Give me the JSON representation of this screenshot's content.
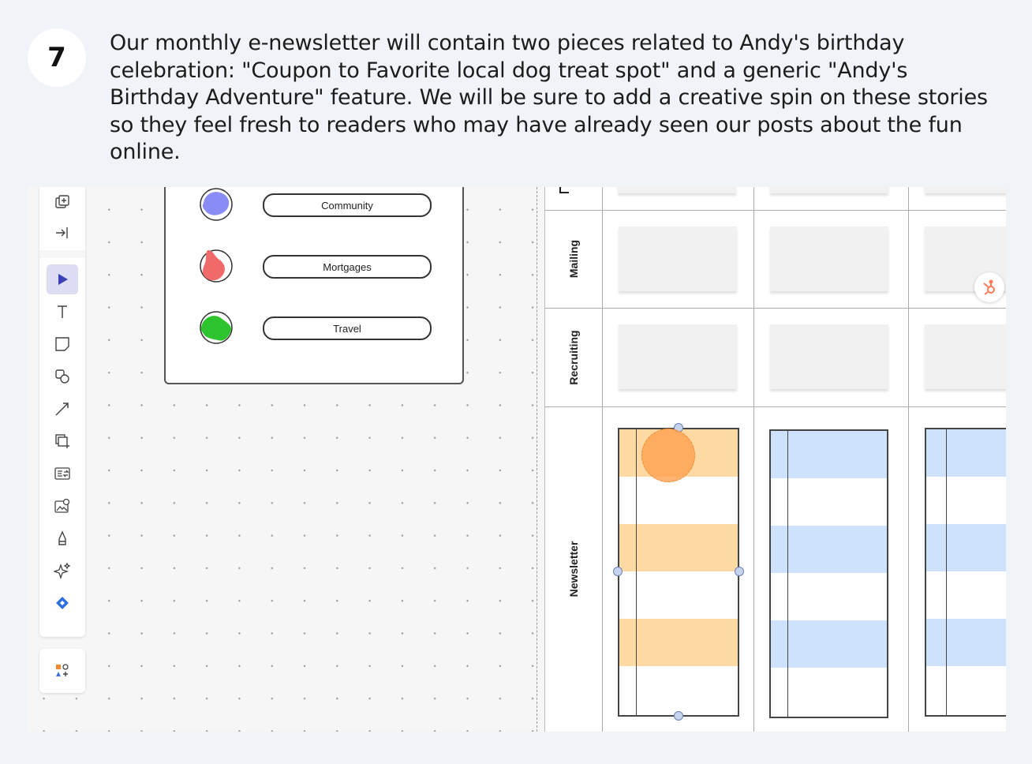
{
  "step": {
    "number": "7",
    "text": "Our monthly e-newsletter will contain two pieces related to Andy's birthday celebration: \"Coupon to Favorite local dog treat spot\" and a generic \"Andy's Birthday Adventure\" feature. We will be sure to add a creative spin on these stories so they feel fresh to readers who may have already seen our posts about the fun online."
  },
  "toolbar": {
    "tools": [
      {
        "name": "frame-add-icon"
      },
      {
        "name": "import-icon"
      },
      {
        "name": "select-pointer-icon",
        "active": true
      },
      {
        "name": "text-icon"
      },
      {
        "name": "sticky-note-icon"
      },
      {
        "name": "shapes-icon"
      },
      {
        "name": "connector-line-icon"
      },
      {
        "name": "frame-icon"
      },
      {
        "name": "data-link-icon"
      },
      {
        "name": "image-search-icon"
      },
      {
        "name": "pen-icon"
      },
      {
        "name": "ai-sparkle-icon"
      },
      {
        "name": "diamond-app-icon"
      }
    ],
    "shapes_library": {
      "name": "shapes-library-icon"
    }
  },
  "legend": {
    "items": [
      {
        "label": "Community",
        "color": "#8a8cf5"
      },
      {
        "label": "Mortgages",
        "color": "#f06a6a"
      },
      {
        "label": "Travel",
        "color": "#2ec42e"
      }
    ]
  },
  "board": {
    "rows": [
      "Mailing",
      "Recruiting",
      "Newsletter"
    ],
    "colors": {
      "orange": "#fdd9a3",
      "blue": "#cfe2fb",
      "cursor": "#ffa050",
      "hubspot": "#ff7a59"
    }
  }
}
